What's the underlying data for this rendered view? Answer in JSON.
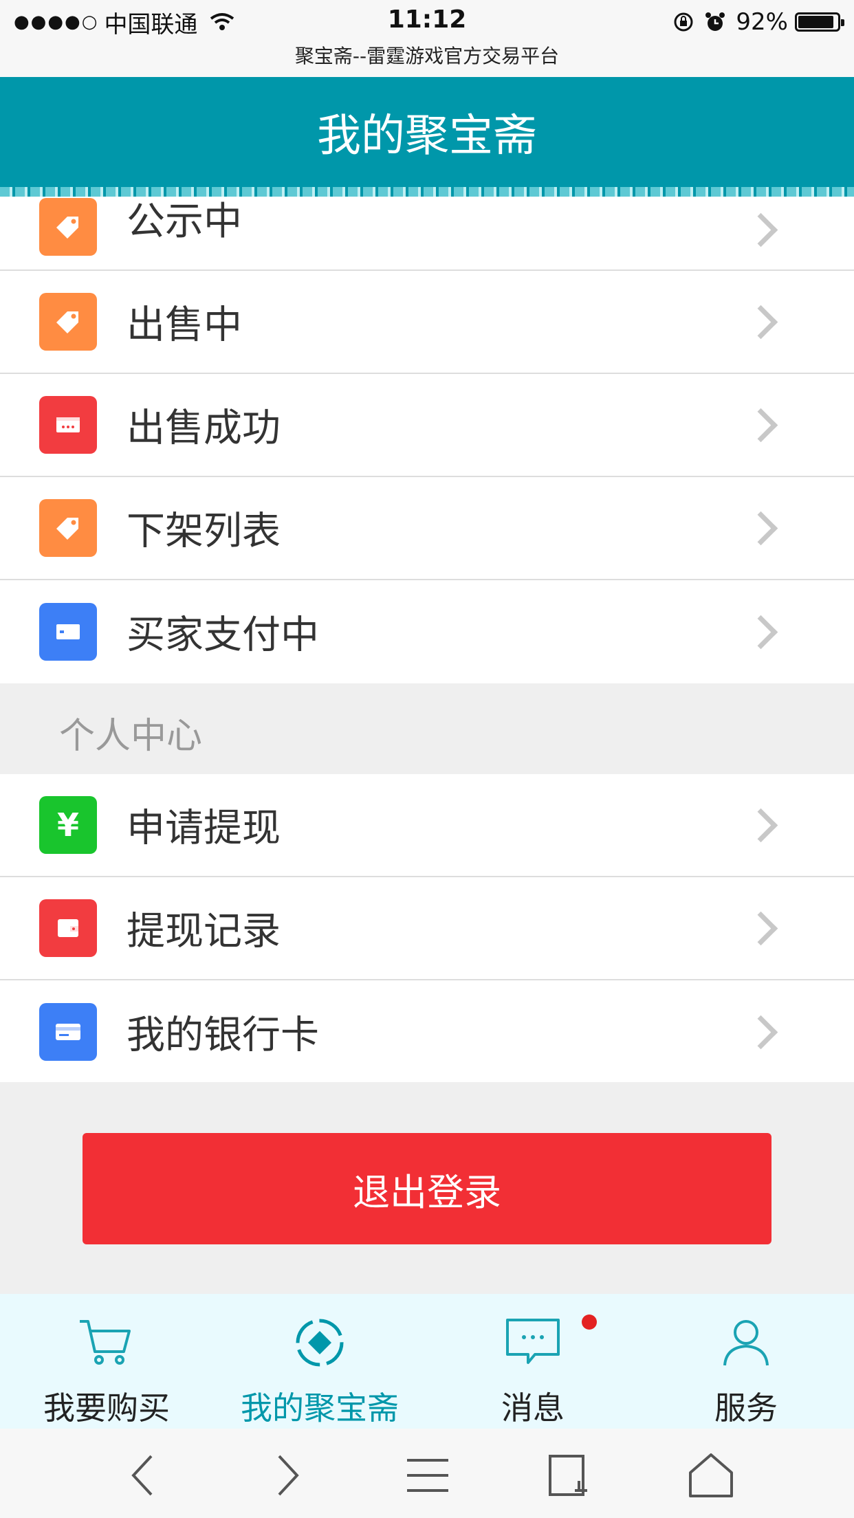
{
  "status_bar": {
    "carrier": "中国联通",
    "time": "11:12",
    "battery": "92%",
    "battery_level": 0.92,
    "page_title": "聚宝斋--雷霆游戏官方交易平台"
  },
  "header": {
    "title": "我的聚宝斋"
  },
  "selling_items": [
    {
      "label": "公示中",
      "icon": "tag-icon",
      "color": "#ff8c42"
    },
    {
      "label": "出售中",
      "icon": "tag-icon",
      "color": "#ff8c42"
    },
    {
      "label": "出售成功",
      "icon": "receipt-icon",
      "color": "#f23c40"
    },
    {
      "label": "下架列表",
      "icon": "tag-icon",
      "color": "#ff8c42"
    },
    {
      "label": "买家支付中",
      "icon": "card-icon",
      "color": "#3d7ff6"
    }
  ],
  "personal_center": {
    "title": "个人中心",
    "items": [
      {
        "label": "申请提现",
        "icon": "yuan-icon",
        "color": "#19c52d"
      },
      {
        "label": "提现记录",
        "icon": "wallet-icon",
        "color": "#f23c40"
      },
      {
        "label": "我的银行卡",
        "icon": "bank-card-icon",
        "color": "#3d7ff6"
      }
    ]
  },
  "logout_label": "退出登录",
  "tabbar": {
    "items": [
      {
        "label": "我要购买",
        "icon": "cart-icon",
        "active": false
      },
      {
        "label": "我的聚宝斋",
        "icon": "treasure-icon",
        "active": true
      },
      {
        "label": "消息",
        "icon": "message-icon",
        "active": false,
        "badge": true
      },
      {
        "label": "服务",
        "icon": "user-icon",
        "active": false
      }
    ]
  },
  "browser_toolbar": [
    "back-icon",
    "forward-icon",
    "menu-icon",
    "tabs-icon",
    "home-icon"
  ],
  "colors": {
    "accent": "#0097aa",
    "logout": "#f22f35",
    "tabbar_bg": "#e9fafe"
  }
}
